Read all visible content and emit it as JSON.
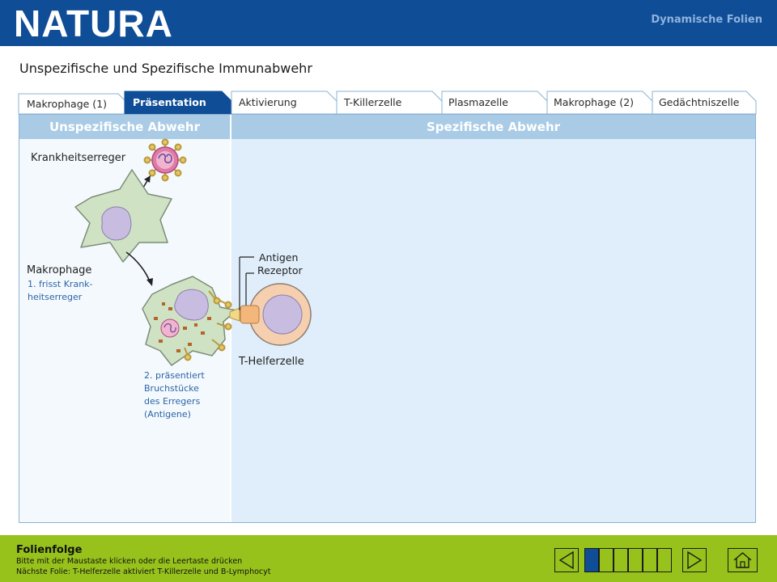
{
  "header": {
    "logo": "NATURA",
    "publication_title": "Dynamische Folien"
  },
  "slide": {
    "title": "Unspezifische und Spezifische Immunabwehr"
  },
  "tabs": [
    {
      "label": "Makrophage (1)",
      "active": false
    },
    {
      "label": "Präsentation",
      "active": true
    },
    {
      "label": "Aktivierung",
      "active": false
    },
    {
      "label": "T-Killerzelle",
      "active": false
    },
    {
      "label": "Plasmazelle",
      "active": false
    },
    {
      "label": "Makrophage (2)",
      "active": false
    },
    {
      "label": "Gedächtniszelle",
      "active": false
    }
  ],
  "sections": {
    "left": "Unspezifische Abwehr",
    "right": "Spezifische Abwehr"
  },
  "diagram": {
    "pathogen_label": "Krankheitserreger",
    "macrophage_label": "Makrophage",
    "step1_line1": "1. frisst Krank-",
    "step1_line2": "heitserreger",
    "step2_line1": "2. präsentiert",
    "step2_line2": "Bruchstücke",
    "step2_line3": "des Erregers",
    "step2_line4": "(Antigene)",
    "antigen_label": "Antigen",
    "receptor_label": "Rezeptor",
    "thelper_label": "T-Helferzelle"
  },
  "footer": {
    "title": "Folienfolge",
    "instruction": "Bitte mit der Maustaste klicken oder die Leertaste drücken",
    "next_slide": "Nächste Folie: T-Helferzelle aktiviert T-Killerzelle und B-Lymphocyt"
  },
  "navigation": {
    "total_slides": 6,
    "current_slide": 1
  },
  "colors": {
    "header_blue": "#0f4d96",
    "active_tab": "#0f4d96",
    "footer_green": "#97c21c",
    "section_header": "#a9cbe6",
    "note_text": "#2d64a8",
    "macrophage_fill": "#cfe3c4",
    "nucleus_fill": "#c8bde0",
    "pathogen_fill": "#e07aa8"
  }
}
